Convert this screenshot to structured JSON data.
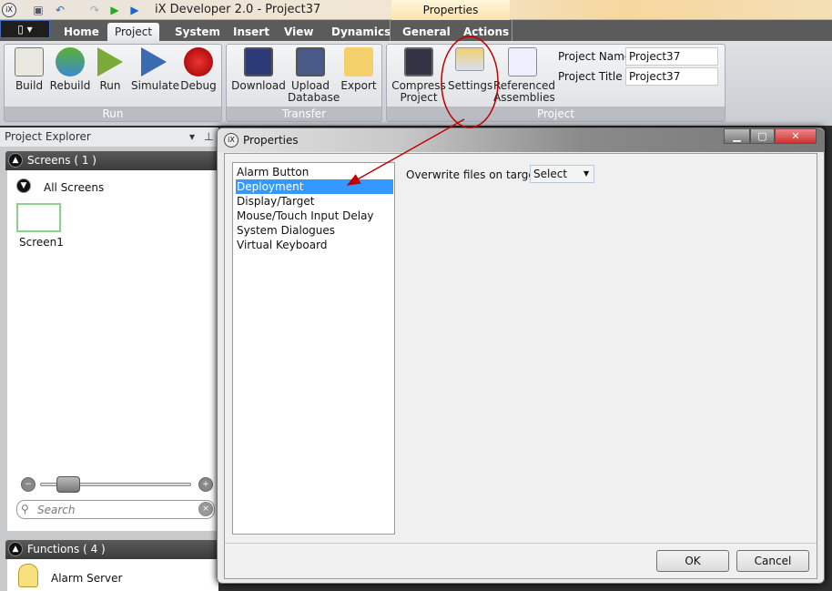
{
  "titlebar": {
    "app_title": "iX Developer 2.0 - Project37",
    "context_header": "Properties"
  },
  "tabs": [
    {
      "label": "Home"
    },
    {
      "label": "Project"
    },
    {
      "label": "System"
    },
    {
      "label": "Insert"
    },
    {
      "label": "View"
    },
    {
      "label": "Dynamics"
    },
    {
      "label": "General"
    },
    {
      "label": "Actions"
    }
  ],
  "ribbon": {
    "run": {
      "label": "Run",
      "buttons": [
        "Build",
        "Rebuild",
        "Run",
        "Simulate",
        "Debug"
      ]
    },
    "transfer": {
      "label": "Transfer",
      "buttons": [
        "Download",
        "Upload\nDatabase",
        "Export"
      ]
    },
    "project": {
      "label": "Project",
      "buttons": [
        "Compress\nProject",
        "Settings",
        "Referenced\nAssemblies"
      ],
      "name_label": "Project Name",
      "name_value": "Project37",
      "title_label": "Project Title",
      "title_value": "Project37"
    }
  },
  "explorer": {
    "title": "Project Explorer",
    "screens_header": "Screens ( 1 )",
    "all_screens": "All Screens",
    "screen1": "Screen1",
    "search_placeholder": "Search",
    "functions_header": "Functions ( 4 )",
    "alarm_server": "Alarm Server"
  },
  "dialog": {
    "title": "Properties",
    "items": [
      "Alarm Button",
      "Deployment",
      "Display/Target",
      "Mouse/Touch Input Delay",
      "System Dialogues",
      "Virtual Keyboard"
    ],
    "selected": "Deployment",
    "overwrite_label": "Overwrite files on target",
    "overwrite_value": "Select",
    "ok": "OK",
    "cancel": "Cancel"
  },
  "colors": {
    "annotation": "#c00000",
    "selection": "#3399ff"
  }
}
